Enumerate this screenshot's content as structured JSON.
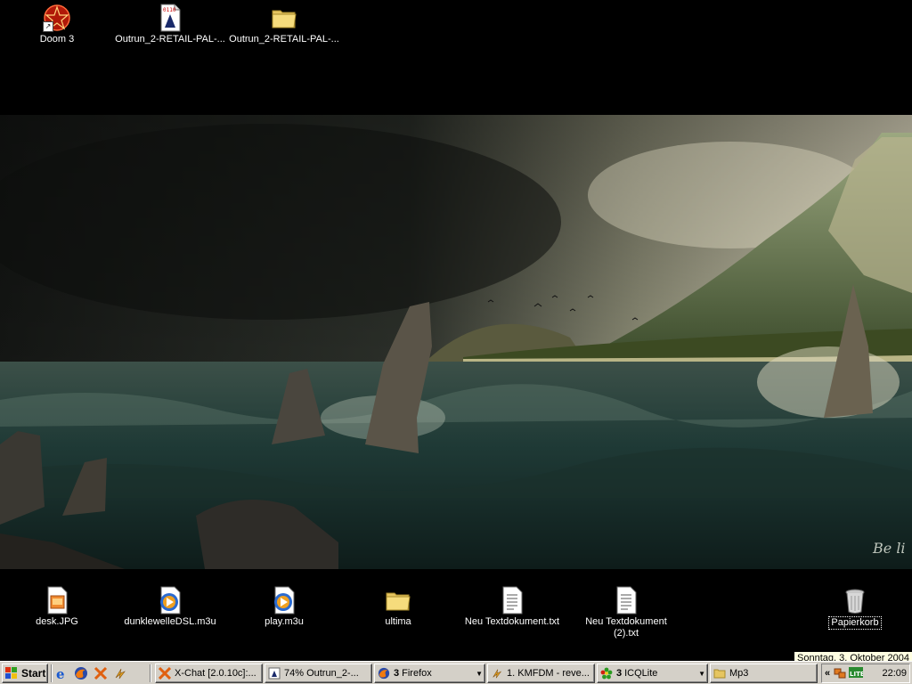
{
  "desktop": {
    "top_icons": [
      {
        "label": "Doom 3",
        "icon": "doom3-shortcut-icon"
      },
      {
        "label": "Outrun_2-RETAIL-PAL-...",
        "icon": "file-icon"
      },
      {
        "label": "Outrun_2-RETAIL-PAL-...",
        "icon": "folder-icon"
      }
    ],
    "bottom_icons": [
      {
        "label": "desk.JPG",
        "icon": "jpg-file-icon"
      },
      {
        "label": "dunklewelleDSL.m3u",
        "icon": "playlist-file-icon"
      },
      {
        "label": "play.m3u",
        "icon": "playlist-file-icon"
      },
      {
        "label": "ultima",
        "icon": "folder-icon"
      },
      {
        "label": "Neu Textdokument.txt",
        "icon": "text-file-icon"
      },
      {
        "label": "Neu Textdokument (2).txt",
        "icon": "text-file-icon"
      },
      {
        "label": "Papierkorb",
        "icon": "recycle-bin-icon"
      }
    ],
    "wallpaper_signature": "Be li"
  },
  "taskbar": {
    "start_label": "Start",
    "quick_launch": [
      "internet-explorer-icon",
      "firefox-icon",
      "xchat-icon",
      "winamp-icon"
    ],
    "buttons": [
      {
        "label": "X-Chat [2.0.10c]:...",
        "icon": "xchat-icon"
      },
      {
        "label": "74% Outrun_2-...",
        "icon": "download-icon"
      },
      {
        "count": "3",
        "label": "Firefox",
        "icon": "firefox-icon",
        "group": true
      },
      {
        "label": "1. KMFDM - reve...",
        "icon": "winamp-icon"
      },
      {
        "count": "3",
        "label": "ICQLite",
        "icon": "icq-flower-icon",
        "group": true
      },
      {
        "label": "Mp3",
        "icon": "folder-icon"
      }
    ],
    "tray": {
      "chevron": "«",
      "icons": [
        "network-icon",
        "lite-icon"
      ],
      "clock": "22:09"
    }
  },
  "tooltip": "Sonntag, 3. Oktober 2004",
  "colors": {
    "taskbar": "#d4d0c8",
    "tooltip_bg": "#ffffe1",
    "desktop": "#000000"
  }
}
